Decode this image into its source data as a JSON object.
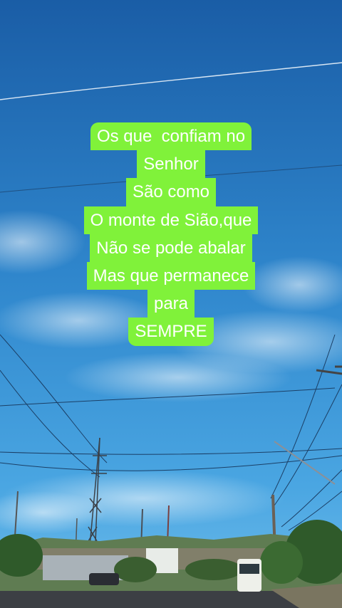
{
  "caption": {
    "lines": [
      "Os que  confiam no",
      "Senhor",
      "São como",
      "O monte de Sião,que",
      "Não se pode abalar",
      "Mas que permanece",
      "para",
      "SEMPRE"
    ],
    "highlight_color": "#80f23a",
    "text_color": "#ffffff"
  },
  "scene": {
    "description_icon": "sky-street-photo",
    "sky_color_top": "#1a5fa8",
    "sky_color_bottom": "#4aa3e0"
  }
}
